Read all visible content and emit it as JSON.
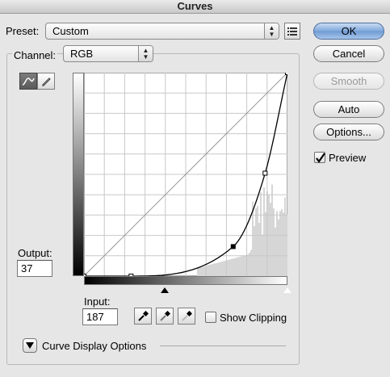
{
  "window": {
    "title": "Curves"
  },
  "preset": {
    "label": "Preset:",
    "value": "Custom",
    "menu_icon": "preset-options-icon"
  },
  "channel": {
    "label": "Channel:",
    "value": "RGB"
  },
  "buttons": {
    "ok": "OK",
    "cancel": "Cancel",
    "smooth": "Smooth",
    "auto": "Auto",
    "options": "Options..."
  },
  "preview": {
    "label": "Preview",
    "checked": true
  },
  "tools": {
    "curve_tool": "curve-tool-icon",
    "pencil_tool": "pencil-icon"
  },
  "output": {
    "label": "Output:",
    "value": "37"
  },
  "input": {
    "label": "Input:",
    "value": "187"
  },
  "eyedroppers": [
    "black-eyedropper-icon",
    "gray-eyedropper-icon",
    "white-eyedropper-icon"
  ],
  "show_clipping": {
    "label": "Show Clipping",
    "checked": false
  },
  "curve_display": {
    "label": "Curve Display Options"
  },
  "curve": {
    "points": [
      [
        0,
        0
      ],
      [
        59,
        0
      ],
      [
        187,
        37
      ],
      [
        227,
        129
      ],
      [
        255,
        255
      ]
    ],
    "selected_point_index": 2,
    "input_range": [
      0,
      255
    ],
    "output_range": [
      0,
      255
    ],
    "grid": true,
    "grid_divisions": 10
  }
}
